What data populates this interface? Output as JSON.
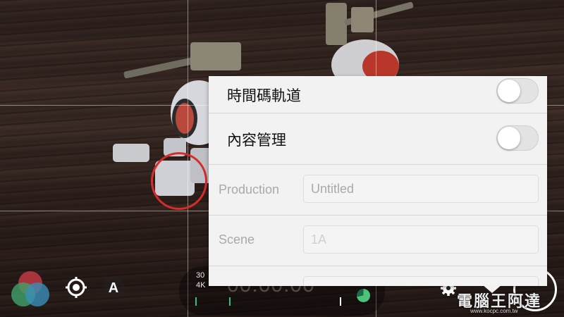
{
  "settings_popover": {
    "toggles": [
      {
        "label": "時間碼軌道",
        "on": false
      },
      {
        "label": "內容管理",
        "on": false
      }
    ],
    "fields": [
      {
        "label": "Production",
        "value": "Untitled"
      },
      {
        "label": "Scene",
        "placeholder": "1A"
      }
    ]
  },
  "recording": {
    "framerate": "30",
    "resolution": "4K",
    "timecode": "00:00:00"
  },
  "toolbar": {
    "color_wheel_icon": "color-wheel-icon",
    "focus_icon": "target-icon",
    "auto_label": "A",
    "settings_icon": "gear-icon"
  },
  "watermark": {
    "text": "電腦王阿達",
    "url": "www.kocpc.com.tw"
  },
  "colors": {
    "focus_ring": "#d62c2c",
    "storage_fill": "#4ec27a",
    "tick": "#2ec27a"
  }
}
